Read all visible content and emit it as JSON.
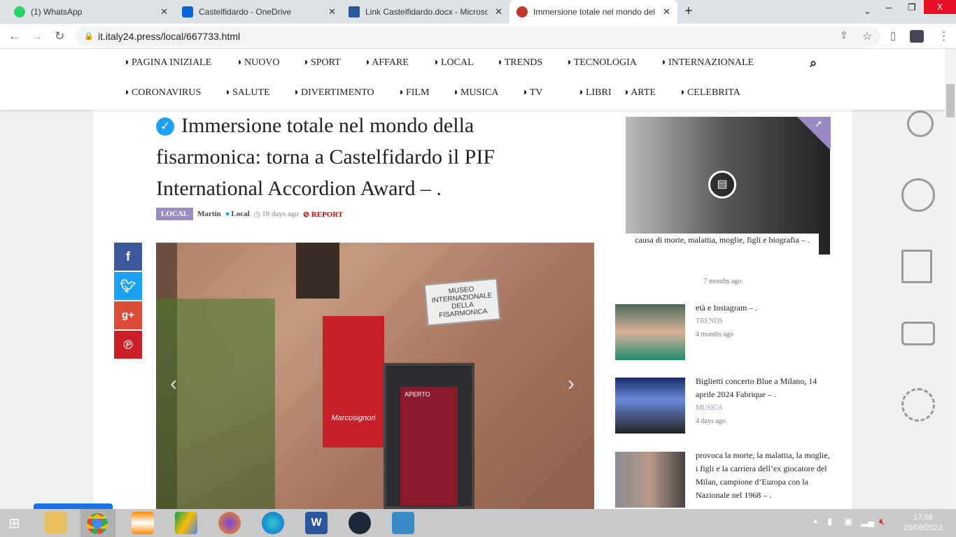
{
  "browser": {
    "tabs": [
      {
        "title": "(1) WhatsApp",
        "color": "#25d366"
      },
      {
        "title": "Castelfidardo - OneDrive",
        "color": "#0a64d6"
      },
      {
        "title": "Link Castelfidardo.docx - Microsoft Word",
        "color": "#2b579a"
      },
      {
        "title": "Immersione totale nel mondo della fisarmonica",
        "color": "#c0392b",
        "active": true
      }
    ],
    "new_tab": "+",
    "url": "it.italy24.press/local/667733.html",
    "window": {
      "minimize": "–",
      "maximize": "❐",
      "close": "X"
    }
  },
  "nav": {
    "row1": [
      "PAGINA INIZIALE",
      "NUOVO",
      "SPORT",
      "AFFARE",
      "LOCAL",
      "TRENDS",
      "TECNOLOGIA",
      "INTERNAZIONALE"
    ],
    "row2": [
      "CORONAVIRUS",
      "SALUTE",
      "DIVERTIMENTO",
      "FILM",
      "MUSICA",
      "TV",
      "LIBRI",
      "ARTE",
      "CELEBRITA"
    ]
  },
  "article": {
    "title": "Immersione totale nel mondo della fisarmonica: torna a Castelfidardo il PIF International Accordion Award – .",
    "category": "LOCAL",
    "author": "Martin",
    "author_category": "Local",
    "time": "18 days ago",
    "report": "REPORT",
    "image_sign": "MUSEO INTERNAZIONALE DELLA FISARMONICA",
    "poster_text": "Marcosignori",
    "aperto": "APERTO"
  },
  "share": [
    {
      "icon": "f",
      "color": "#3b5998"
    },
    {
      "icon": "t",
      "color": "#1da1f2"
    },
    {
      "icon": "g+",
      "color": "#dd4b39"
    },
    {
      "icon": "p",
      "color": "#cb2027"
    }
  ],
  "sidebar": {
    "featured": {
      "title": "causa di morte, malattia, moglie, figli e biografia – .",
      "date": "7 months ago"
    },
    "items": [
      {
        "title": "età e Instagram – .",
        "category": "TRENDS",
        "date": "4 months ago"
      },
      {
        "title": "Biglietti concerto Blue a Milano, 14 aprile 2024 Fabrique – .",
        "category": "MUSICA",
        "date": "4 days ago"
      },
      {
        "title": "provoca la morte, la malattia, la moglie, i figli e la carriera dell’ex giocatore del Milan, campione d’Europa con la Nazionale nel 1968 – .",
        "category": "",
        "date": ""
      }
    ]
  },
  "taskbar": {
    "time": "17:58",
    "date": "25/09/2023"
  }
}
